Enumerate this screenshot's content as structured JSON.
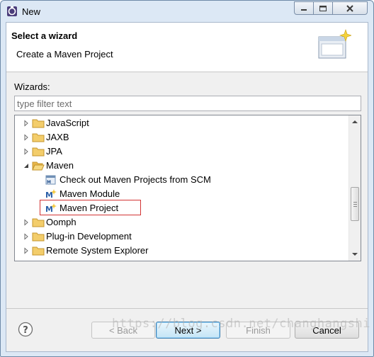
{
  "window": {
    "title": "New",
    "icon": "eclipse-new-wizard-icon"
  },
  "titlebar_buttons": {
    "minimize_icon": "minimize-icon",
    "maximize_icon": "maximize-icon",
    "close_icon": "close-icon"
  },
  "banner": {
    "title": "Select a wizard",
    "description": "Create a Maven Project",
    "image": "wizard-banner-icon"
  },
  "wizards": {
    "label": "Wizards:",
    "filter_placeholder": "type filter text",
    "filter_value": ""
  },
  "tree": {
    "items": [
      {
        "label": "JavaScript",
        "kind": "folder",
        "expanded": false
      },
      {
        "label": "JAXB",
        "kind": "folder",
        "expanded": false
      },
      {
        "label": "JPA",
        "kind": "folder",
        "expanded": false
      },
      {
        "label": "Maven",
        "kind": "folder",
        "expanded": true
      },
      {
        "label": "Check out Maven Projects from SCM",
        "kind": "wizard",
        "icon": "maven-scm-icon"
      },
      {
        "label": "Maven Module",
        "kind": "wizard",
        "icon": "maven-module-icon"
      },
      {
        "label": "Maven Project",
        "kind": "wizard",
        "icon": "maven-project-icon",
        "selected": true
      },
      {
        "label": "Oomph",
        "kind": "folder",
        "expanded": false
      },
      {
        "label": "Plug-in Development",
        "kind": "folder",
        "expanded": false
      },
      {
        "label": "Remote System Explorer",
        "kind": "folder",
        "expanded": false
      }
    ]
  },
  "buttons": {
    "help_icon": "help-icon",
    "back": "< Back",
    "next": "Next >",
    "finish": "Finish",
    "cancel": "Cancel"
  },
  "watermark": "https://blog.csdn.net/changhangshi",
  "colors": {
    "selection_border": "#d23434",
    "folder": "#e8b64a",
    "dialog_bg": "#f0f0f0"
  }
}
